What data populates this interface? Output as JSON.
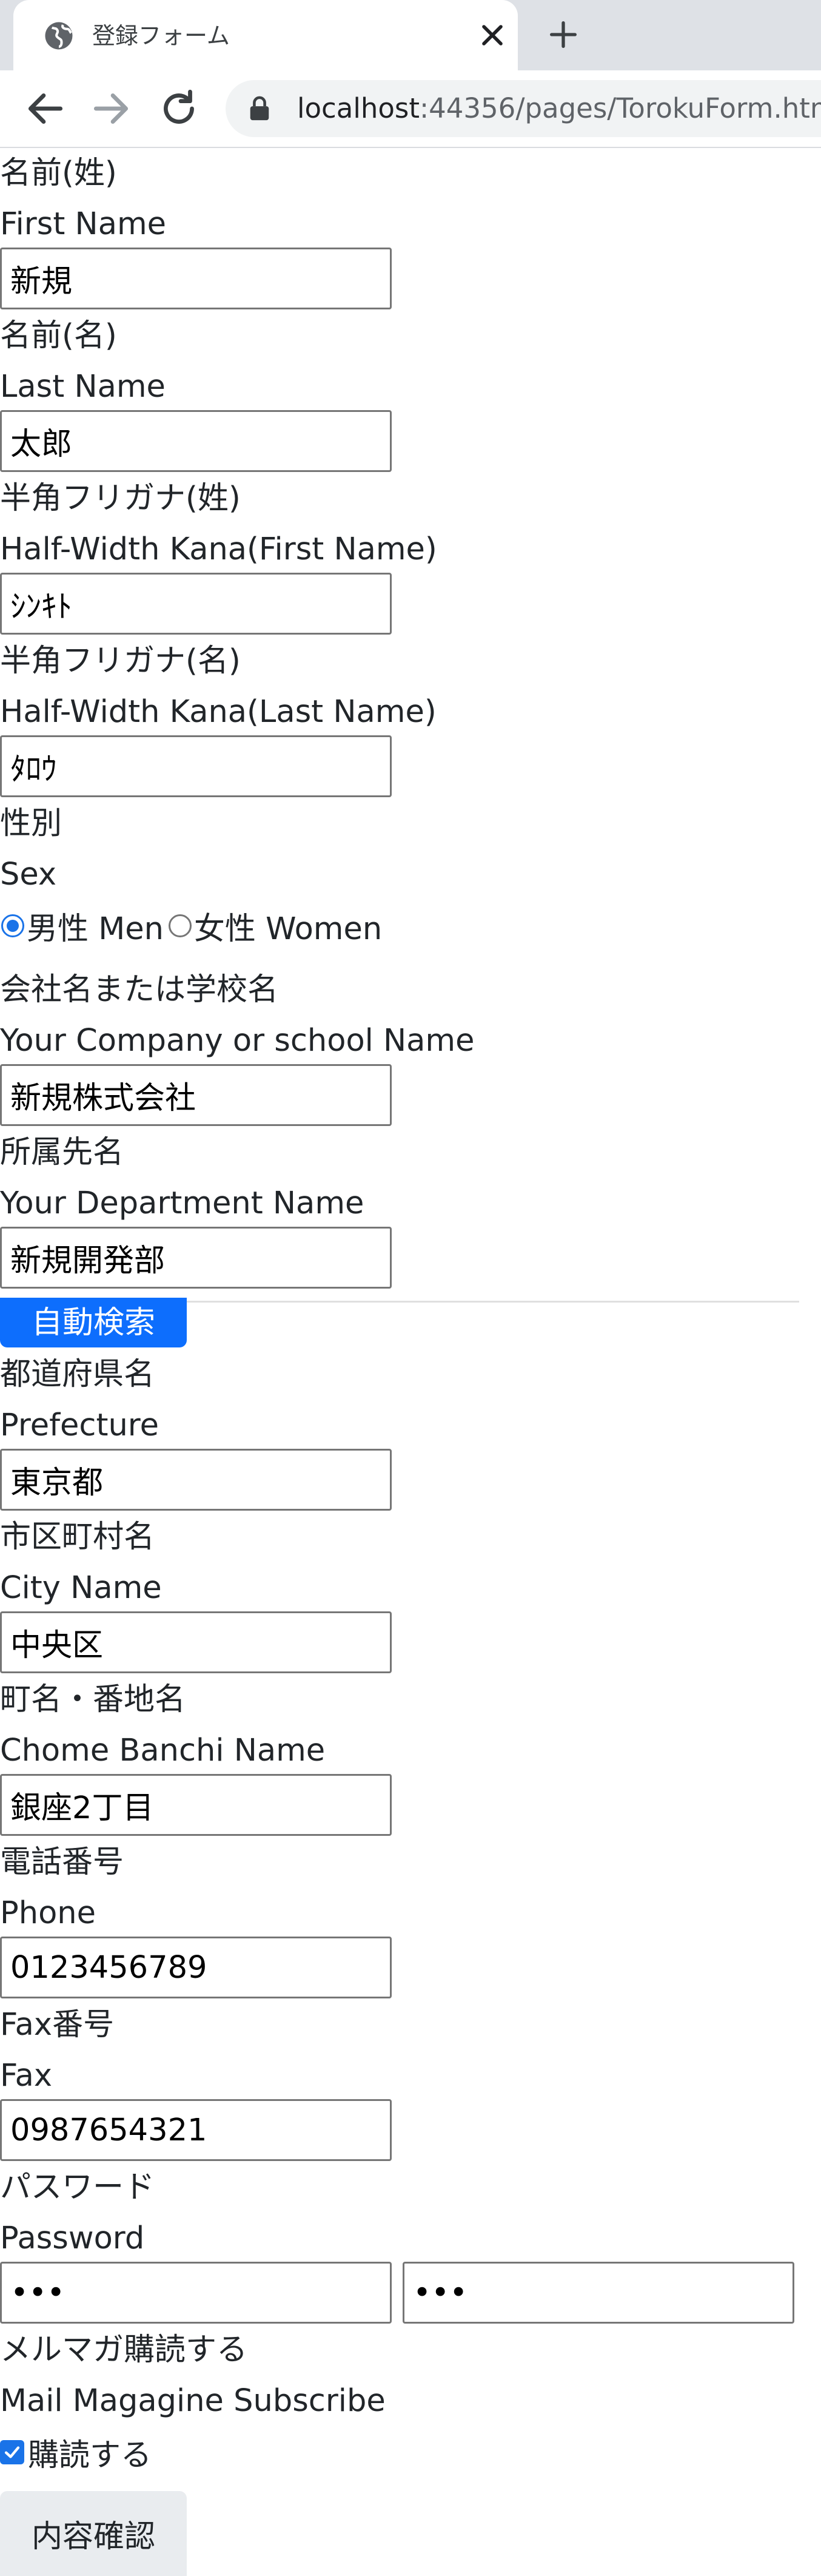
{
  "browser": {
    "tab_title": "登録フォーム",
    "url_host": "localhost",
    "url_rest": ":44356/pages/TorokuForm.html"
  },
  "form": {
    "first_name": {
      "label_ja": "名前(姓)",
      "label_en": "First Name",
      "value": "新規"
    },
    "last_name": {
      "label_ja": "名前(名)",
      "label_en": "Last Name",
      "value": "太郎"
    },
    "kana_first": {
      "label_ja": "半角フリガナ(姓)",
      "label_en": "Half-Width Kana(First Name)",
      "value": "ｼﾝｷﾄ"
    },
    "kana_last": {
      "label_ja": "半角フリガナ(名)",
      "label_en": "Half-Width Kana(Last Name)",
      "value": "ﾀﾛｳ"
    },
    "sex": {
      "label_ja": "性別",
      "label_en": "Sex",
      "male_label": "男性 Men",
      "female_label": "女性 Women",
      "selected": "male"
    },
    "company": {
      "label_ja": "会社名または学校名",
      "label_en": "Your Company or school Name",
      "value": "新規株式会社"
    },
    "department": {
      "label_ja": "所属先名",
      "label_en": "Your Department Name",
      "value": "新規開発部"
    },
    "auto_search_label": "自動検索",
    "prefecture": {
      "label_ja": "都道府県名",
      "label_en": "Prefecture",
      "value": "東京都"
    },
    "city": {
      "label_ja": "市区町村名",
      "label_en": "City Name",
      "value": "中央区"
    },
    "chome": {
      "label_ja": "町名・番地名",
      "label_en": "Chome Banchi Name",
      "value": "銀座2丁目"
    },
    "phone": {
      "label_ja": "電話番号",
      "label_en": "Phone",
      "value": "0123456789"
    },
    "fax": {
      "label_ja": "Fax番号",
      "label_en": "Fax",
      "value": "0987654321"
    },
    "password": {
      "label_ja": "パスワード",
      "label_en": "Password",
      "value": "abc",
      "confirm_value": "abc"
    },
    "newsletter": {
      "label_ja": "メルマガ購読する",
      "label_en": "Mail Magagine Subscribe",
      "checkbox_label": "購読する",
      "checked": true
    },
    "confirm_label": "内容確認"
  }
}
